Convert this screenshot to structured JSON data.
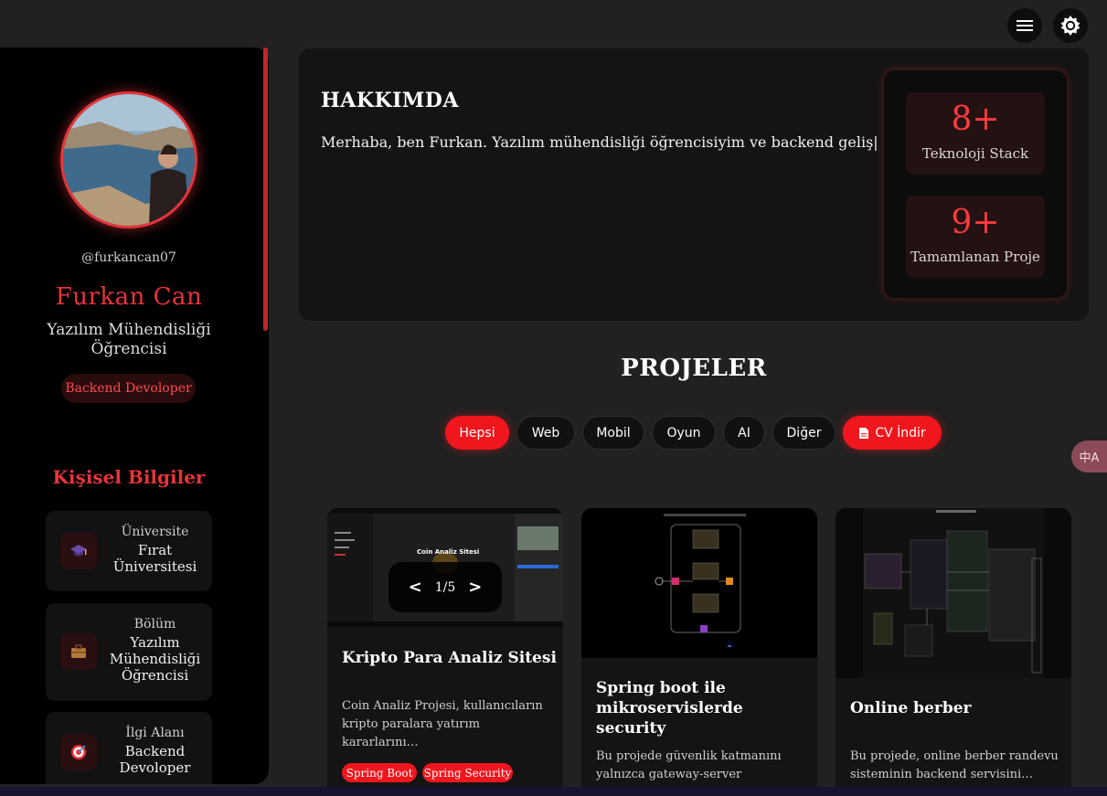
{
  "header": {
    "menu_icon": "hamburger-icon",
    "theme_icon": "sun-icon"
  },
  "profile": {
    "username": "@furkancan07",
    "name": "Furkan Can",
    "role": "Yazılım Mühendisliği Öğrencisi",
    "badge": "Backend Devoloper"
  },
  "personal": {
    "title": "Kişisel Bilgiler",
    "items": [
      {
        "label": "Üniversite",
        "value": "Fırat Üniversitesi",
        "icon": "graduation-cap-icon"
      },
      {
        "label": "Bölüm",
        "value": "Yazılım Mühendisliği Öğrencisi",
        "icon": "briefcase-icon"
      },
      {
        "label": "İlgi Alanı",
        "value": "Backend Devoloper",
        "icon": "target-icon"
      }
    ]
  },
  "about": {
    "title": "HAKKIMDA",
    "text": "Merhaba, ben Furkan. Yazılım mühendisliği öğrencisiyim ve backend geliş|",
    "stats": [
      {
        "value": "8+",
        "label": "Teknoloji Stack"
      },
      {
        "value": "9+",
        "label": "Tamamlanan Proje"
      }
    ]
  },
  "projects": {
    "title": "PROJELER",
    "filters": [
      "Hepsi",
      "Web",
      "Mobil",
      "Oyun",
      "AI",
      "Diğer"
    ],
    "active_filter": "Hepsi",
    "cv_button": "CV İndir",
    "cards": [
      {
        "title": "Kripto Para Analiz Sitesi",
        "description": "Coin Analiz Projesi, kullanıcıların kripto paralara yatırım kararlarını…",
        "tags": [
          "Spring Boot",
          "Spring Security"
        ],
        "carousel": "1/5",
        "image_caption": "Coin Analiz Sitesi"
      },
      {
        "title": "Spring boot ile mikroservislerde security",
        "description": "Bu projede güvenlik katmanını yalnızca gateway-server üzerinden…",
        "tags": []
      },
      {
        "title": "Online berber",
        "description": "Bu projede, online berber randevu sisteminin backend servisini…",
        "tags": []
      }
    ]
  },
  "translate_button": "中A",
  "colors": {
    "accent": "#e8333a",
    "background": "#212121",
    "sidebar": "#000000"
  }
}
